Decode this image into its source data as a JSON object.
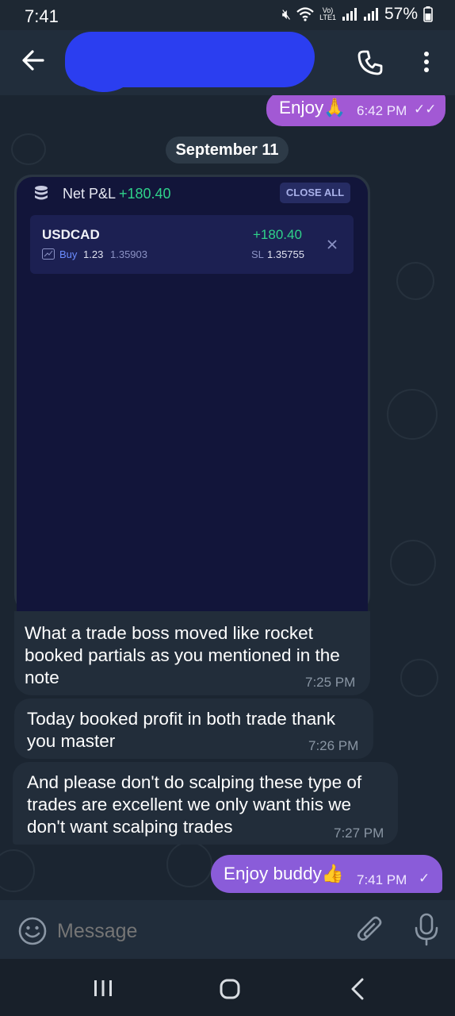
{
  "status_bar": {
    "time": "7:41",
    "lte_top": "Vo)",
    "lte_bottom": "LTE1",
    "battery": "57%"
  },
  "header": {
    "contact_name": "",
    "icons": [
      "back-arrow-icon",
      "phone-icon",
      "more-vert-icon"
    ]
  },
  "messages": {
    "m1": {
      "text": "Enjoy🙏",
      "time": "6:42 PM",
      "ticks": "✓✓"
    },
    "date": "September 11",
    "card": {
      "net_label": "Net P&L",
      "net_value": "+180.40",
      "close_all": "CLOSE ALL",
      "symbol": "USDCAD",
      "side": "Buy",
      "lots": "1.23",
      "entry": "1.35903",
      "pnl": "+180.40",
      "sl_label": "SL",
      "sl_value": "1.35755"
    },
    "m2": {
      "text": "What a trade boss moved like rocket booked partials as you mentioned in the note",
      "time": "7:25 PM"
    },
    "m3": {
      "text": "Today booked profit in both trade thank you master",
      "time": "7:26 PM"
    },
    "m4": {
      "text": "And please don't do scalping these type of trades are excellent we only want this we don't  want scalping trades",
      "time": "7:27 PM"
    },
    "m5": {
      "text": "Enjoy buddy👍",
      "time": "7:41 PM",
      "ticks": "✓"
    }
  },
  "composer": {
    "placeholder": "Message",
    "icons": [
      "emoji-icon",
      "attach-icon",
      "mic-icon"
    ]
  },
  "nav": {
    "icons": [
      "recents-icon",
      "home-icon",
      "back-icon"
    ]
  },
  "colors": {
    "accent_out": "#8a5cd9",
    "pnl_green": "#2fd28a",
    "bg": "#1b2531"
  }
}
